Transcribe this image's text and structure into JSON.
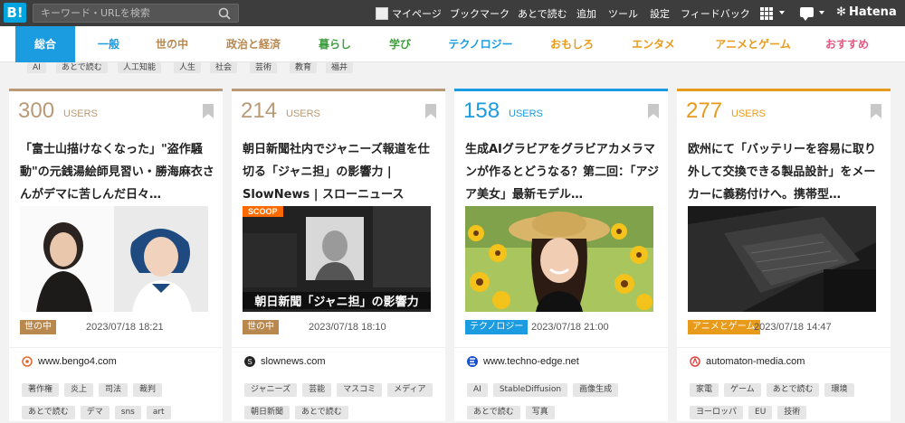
{
  "header": {
    "logo": "B!",
    "search_placeholder": "キーワード・URLを検索",
    "nav": [
      "マイページ",
      "ブックマーク",
      "あとで読む",
      "追加",
      "ツール",
      "設定",
      "フィードバック"
    ],
    "brand_mark": "✻",
    "brand": "Hatena"
  },
  "tabs": [
    {
      "label": "総合",
      "color": "#1b9be0",
      "active": true
    },
    {
      "label": "一般",
      "color": "#1b9be0"
    },
    {
      "label": "世の中",
      "color": "#b8884f"
    },
    {
      "label": "政治と経済",
      "color": "#b8884f"
    },
    {
      "label": "暮らし",
      "color": "#3e9d3e"
    },
    {
      "label": "学び",
      "color": "#3e9d3e"
    },
    {
      "label": "テクノロジー",
      "color": "#1b9be0"
    },
    {
      "label": "おもしろ",
      "color": "#e89a1a"
    },
    {
      "label": "エンタメ",
      "color": "#e89a1a"
    },
    {
      "label": "アニメとゲーム",
      "color": "#e89a1a"
    },
    {
      "label": "おすすめ",
      "color": "#e05a82"
    }
  ],
  "prev_row": {
    "tags": [
      "AI",
      "あとで読む",
      "人工知能",
      "人生",
      "社会",
      "芸術",
      "教育",
      "福井"
    ]
  },
  "cards": [
    {
      "users": "300",
      "users_label": "USERS",
      "accent": "#b89a76",
      "title": "「富士山描けなくなった」\"盗作騒動\"の元銭湯絵師見習い・勝海麻衣さんがデマに苦しんだ日々…",
      "category": "世の中",
      "category_color": "#b8884f",
      "date": "2023/07/18 18:21",
      "site": "www.bengo4.com",
      "site_icon_color": "#e8632a",
      "tags": [
        "著作権",
        "炎上",
        "司法",
        "裁判",
        "あとで読む",
        "デマ",
        "sns",
        "art"
      ]
    },
    {
      "users": "214",
      "users_label": "USERS",
      "accent": "#b89a76",
      "title": "朝日新聞社内でジャニーズ報道を仕切る「ジャニ担」の影響力 | SlowNews | スローニュース",
      "category": "世の中",
      "category_color": "#b8884f",
      "date": "2023/07/18 18:10",
      "site": "slownews.com",
      "site_icon_color": "#222222",
      "thumb_label": "SCOOP",
      "thumb_caption": "朝日新聞「ジャニ担」の影響力",
      "tags": [
        "ジャニーズ",
        "芸能",
        "マスコミ",
        "メディア",
        "朝日新聞",
        "あとで読む"
      ]
    },
    {
      "users": "158",
      "users_label": "USERS",
      "accent": "#1b9be0",
      "title": "生成AIグラビアをグラビアカメラマンが作るとどうなる？第二回：「アジア美女」最新モデル…",
      "category": "テクノロジー",
      "category_color": "#1b9be0",
      "date": "2023/07/18 21:00",
      "site": "www.techno-edge.net",
      "site_icon_color": "#1a4fd0",
      "tags": [
        "AI",
        "StableDiffusion",
        "画像生成",
        "あとで読む",
        "写真"
      ]
    },
    {
      "users": "277",
      "users_label": "USERS",
      "accent": "#e89a1a",
      "title": "欧州にて「バッテリーを容易に取り外して交換できる製品設計」をメーカーに義務付けへ。携帯型…",
      "category": "アニメとゲーム",
      "category_color": "#e89a1a",
      "date": "2023/07/18 14:47",
      "site": "automaton-media.com",
      "site_icon_color": "#e0443c",
      "tags": [
        "家電",
        "ゲーム",
        "あとで読む",
        "環境",
        "ヨーロッパ",
        "EU",
        "技術"
      ]
    }
  ]
}
